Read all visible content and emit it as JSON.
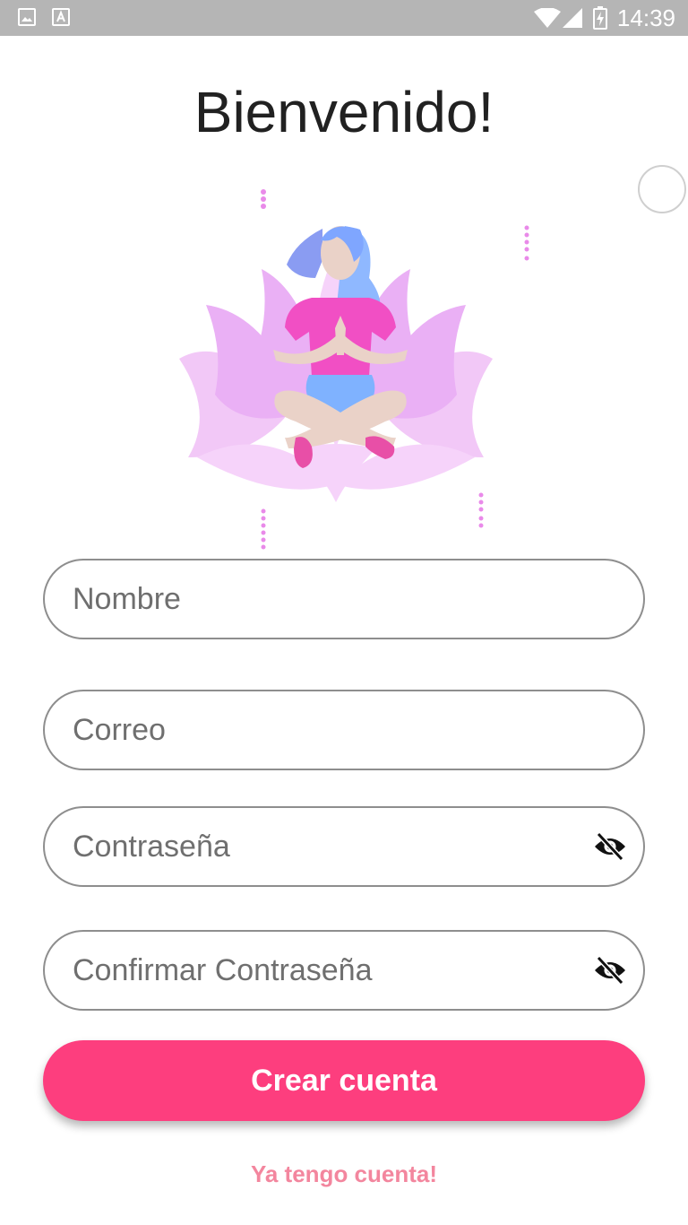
{
  "status_bar": {
    "time": "14:39",
    "icons": [
      "image-icon",
      "accessibility-a-icon",
      "wifi-icon",
      "signal-icon",
      "battery-charging-icon"
    ]
  },
  "title": "Bienvenido!",
  "illustration": {
    "icon": "meditation-lotus-illustration"
  },
  "form": {
    "name_placeholder": "Nombre",
    "email_placeholder": "Correo",
    "password_placeholder": "Contraseña",
    "confirm_password_placeholder": "Confirmar Contraseña",
    "visibility_icon": "eye-off-icon"
  },
  "actions": {
    "create_account_label": "Crear cuenta",
    "have_account_label": "Ya tengo cuenta!"
  },
  "colors": {
    "primary": "#fd3e7e",
    "link": "#f3869e",
    "status_bar": "#b5b5b5",
    "border": "#8e8e8e"
  }
}
